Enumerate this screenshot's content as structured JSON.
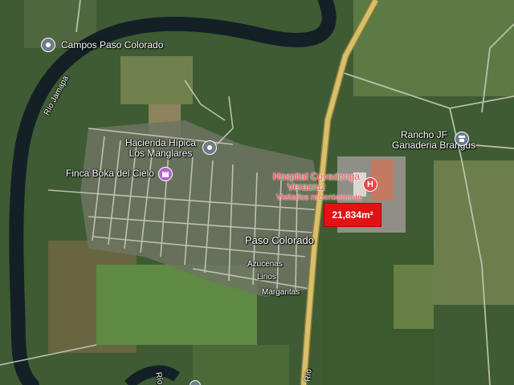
{
  "places": {
    "campos": "Campos Paso Colorado",
    "hacienda_line1": "Hacienda Hípica",
    "hacienda_line2": "Los Manglares",
    "finca": "Finca Boka del Cielo",
    "hospital_line1": "Hospital Covadonga",
    "hospital_line2": "Veracruz",
    "hospital_sub": "Visitados recientemente",
    "rancho_line1": "Rancho JF",
    "rancho_line2": "Ganaderia Brangus",
    "town": "Paso Colorado",
    "street1": "Azucenas",
    "street2": "Lirios",
    "street3": "Margaritas",
    "river_top": "Río Jamapa",
    "river_bottom": "Río",
    "road_bottom": "Río"
  },
  "badge": {
    "area": "21,834m²"
  },
  "colors": {
    "river": "#142026",
    "road": "#d8bf6a",
    "badge": "#e31212",
    "hospital_text": "#ff4a4a"
  },
  "icons": {
    "campos": "map-pin-icon",
    "hacienda": "map-pin-icon",
    "finca": "castle-icon",
    "hospital": "hospital-icon",
    "rancho": "store-icon"
  }
}
